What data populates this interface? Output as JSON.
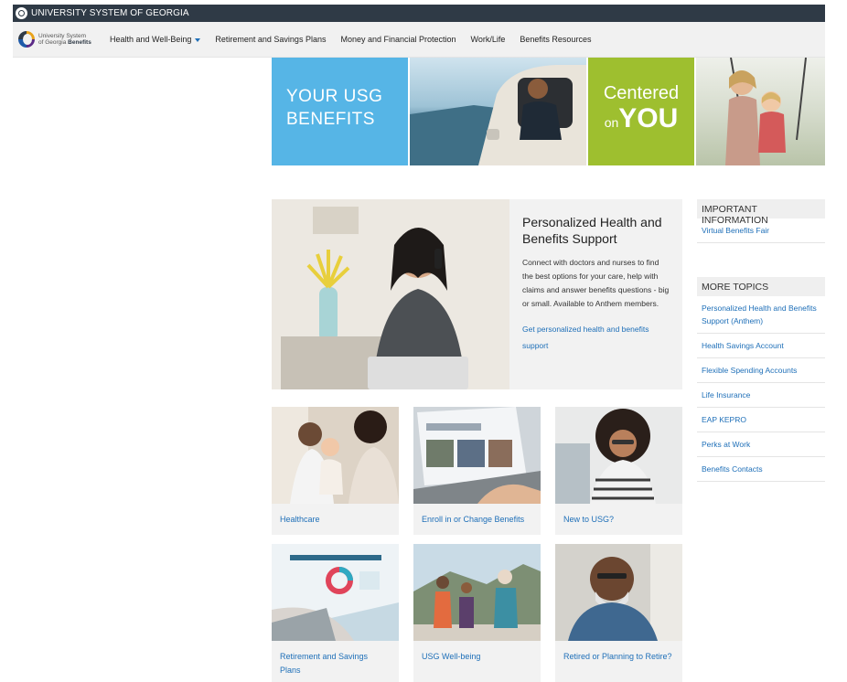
{
  "topbar": {
    "title": "UNIVERSITY SYSTEM OF GEORGIA"
  },
  "logo": {
    "line1": "University System",
    "line2a": "of Georgia",
    "line2b": "Benefits"
  },
  "nav": {
    "items": [
      "Health and Well-Being",
      "Retirement and Savings Plans",
      "Money and Financial Protection",
      "Work/Life",
      "Benefits Resources"
    ],
    "accent": "#1e6fb8"
  },
  "hero": {
    "blue_line1": "YOUR USG",
    "blue_line2": "BENEFITS",
    "green_line1": "Centered",
    "green_line2": "on",
    "green_line3": "YOU",
    "colors": {
      "blue": "#56b5e6",
      "green": "#9ebf2f"
    }
  },
  "feature": {
    "title": "Personalized Health and Benefits Support",
    "text": "Connect with doctors and nurses to find the best options for your care, help with claims and answer benefits questions - big or small. Available to Anthem members.",
    "link": "Get personalized health and benefits support"
  },
  "cards": [
    {
      "label": "Healthcare"
    },
    {
      "label": "Enroll in or Change Benefits"
    },
    {
      "label": "New to USG?"
    },
    {
      "label": "Retirement and Savings Plans"
    },
    {
      "label": "USG Well-being"
    },
    {
      "label": "Retired or Planning to Retire?"
    }
  ],
  "sidebar": {
    "important_heading": "IMPORTANT INFORMATION",
    "important_links": [
      "Virtual Benefits Fair"
    ],
    "more_heading": "MORE TOPICS",
    "more_links": [
      "Personalized Health and Benefits Support (Anthem)",
      "Health Savings Account",
      "Flexible Spending Accounts",
      "Life Insurance",
      "EAP KEPRO",
      "Perks at Work",
      "Benefits Contacts"
    ]
  }
}
